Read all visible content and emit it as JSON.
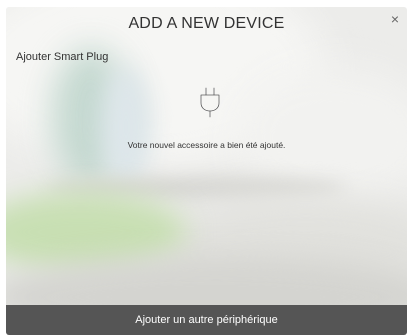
{
  "dialog": {
    "title": "ADD A NEW DEVICE",
    "close_label": "×",
    "subtitle": "Ajouter Smart Plug",
    "icon": "plug-icon",
    "message": "Votre nouvel accessoire a bien été ajouté.",
    "action_label": "Ajouter un autre périphérique"
  },
  "colors": {
    "footer_bg": "#555555",
    "footer_text": "#ffffff",
    "text": "#333333"
  }
}
